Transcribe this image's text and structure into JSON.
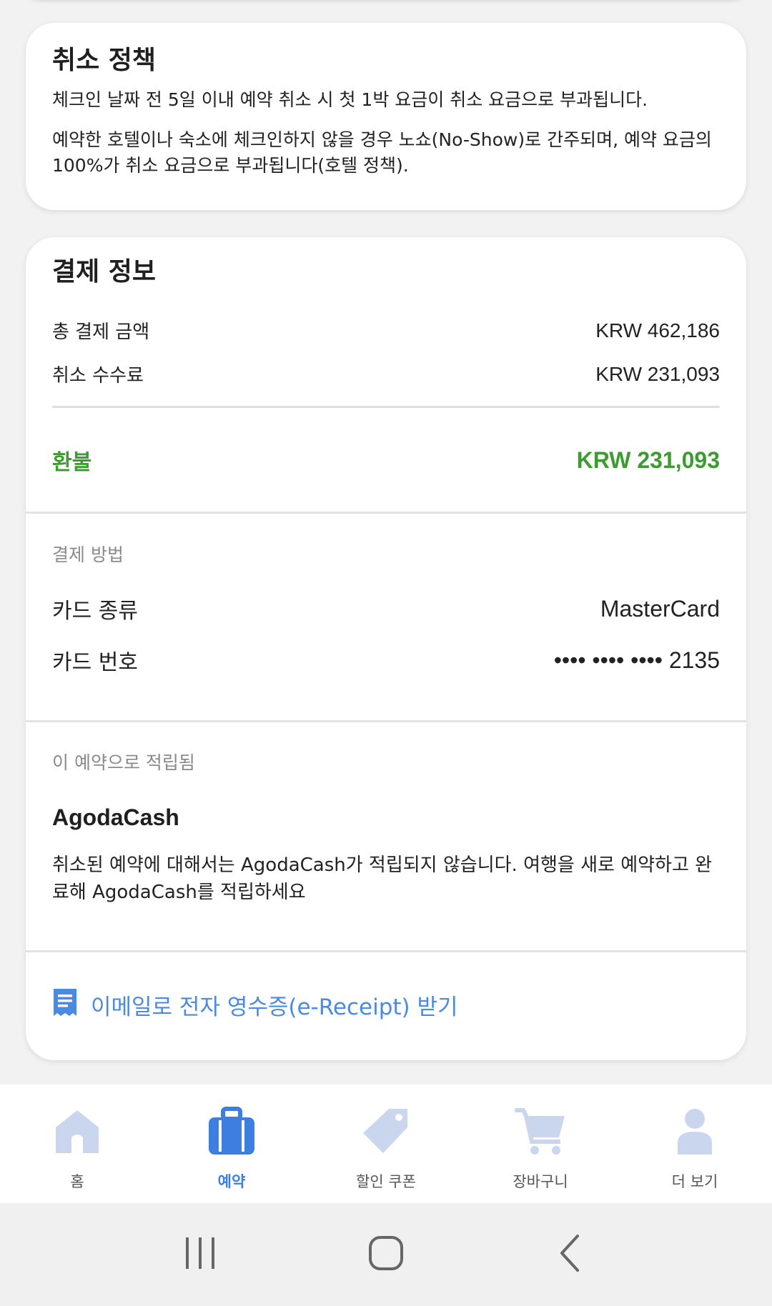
{
  "cancel_policy": {
    "title": "취소 정책",
    "line1": "체크인 날짜 전 5일 이내 예약 취소 시 첫 1박 요금이 취소 요금으로 부과됩니다.",
    "line2": "예약한 호텔이나 숙소에 체크인하지 않을 경우 노쇼(No-Show)로 간주되며, 예약 요금의 100%가 취소 요금으로 부과됩니다(호텔 정책)."
  },
  "payment": {
    "title": "결제 정보",
    "total_label": "총 결제 금액",
    "total_value": "KRW 462,186",
    "fee_label": "취소 수수료",
    "fee_value": "KRW 231,093",
    "refund_label": "환불",
    "refund_value": "KRW 231,093",
    "method_section": "결제 방법",
    "card_type_label": "카드 종류",
    "card_type_value": "MasterCard",
    "card_number_label": "카드 번호",
    "card_number_value": "•••• •••• •••• 2135",
    "earned_section": "이 예약으로 적립됨",
    "agoda_title": "AgodaCash",
    "agoda_text": "취소된 예약에 대해서는 AgodaCash가 적립되지 않습니다. 여행을 새로 예약하고 완료해 AgodaCash를 적립하세요",
    "receipt_link": "이메일로 전자 영수증(e-Receipt) 받기",
    "receipt_icon": "receipt-icon"
  },
  "bottom_nav": {
    "items": [
      {
        "label": "홈",
        "icon": "home-icon",
        "active": false
      },
      {
        "label": "예약",
        "icon": "suitcase-icon",
        "active": true
      },
      {
        "label": "할인 쿠폰",
        "icon": "tag-icon",
        "active": false
      },
      {
        "label": "장바구니",
        "icon": "cart-icon",
        "active": false
      },
      {
        "label": "더 보기",
        "icon": "person-icon",
        "active": false
      }
    ]
  },
  "colors": {
    "refund_green": "#3d9c2f",
    "link_blue": "#4a8ae0",
    "nav_active": "#3d7fe0",
    "nav_inactive_icon": "#c9d6ee"
  }
}
